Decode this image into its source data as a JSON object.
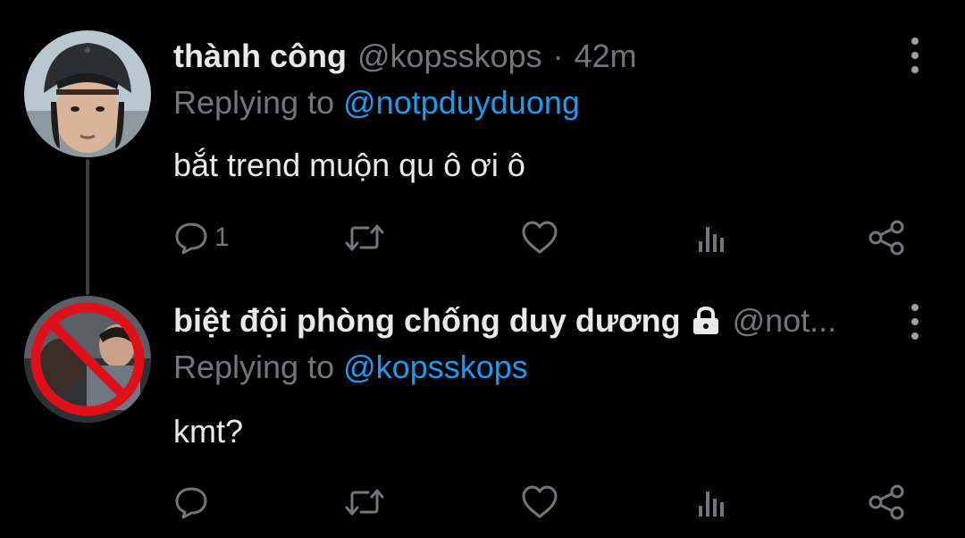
{
  "colors": {
    "background": "#000000",
    "text": "#e7e9ea",
    "muted": "#71767b",
    "link": "#1d9bf0",
    "thread": "#3a3d41"
  },
  "tweets": [
    {
      "display_name": "thành công",
      "handle": "@kopsskops",
      "separator": "·",
      "time": "42m",
      "replying_prefix": "Replying to",
      "replying_to": "@notpduyduong",
      "text": "bắt trend muộn qu ô ơi ô",
      "reply_count": "1",
      "icons": [
        "reply-icon",
        "retweet-icon",
        "like-icon",
        "views-icon",
        "share-icon",
        "more-icon"
      ]
    },
    {
      "display_name": "biệt đội phòng chống duy dương",
      "handle": "@not...",
      "protected": true,
      "replying_prefix": "Replying to",
      "replying_to": "@kopsskops",
      "text": "kmt?",
      "icons": [
        "reply-icon",
        "retweet-icon",
        "like-icon",
        "views-icon",
        "share-icon",
        "more-icon",
        "lock-icon"
      ]
    }
  ]
}
